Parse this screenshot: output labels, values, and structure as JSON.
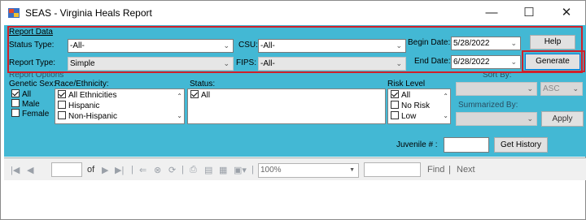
{
  "window": {
    "title": "SEAS - Virginia Heals Report",
    "controls": {
      "minimize": "—",
      "maximize": "☐",
      "close": "✕"
    }
  },
  "report_data": {
    "section_label": "Report Data",
    "status_type": {
      "label": "Status Type:",
      "value": "-All-"
    },
    "report_type": {
      "label": "Report Type:",
      "value": "Simple"
    },
    "csu": {
      "label": "CSU:",
      "value": "-All-"
    },
    "fips": {
      "label": "FIPS:",
      "value": "-All-"
    },
    "begin_date": {
      "label": "Begin Date:",
      "value": "5/28/2022"
    },
    "end_date": {
      "label": "End Date:",
      "value": "6/28/2022"
    },
    "help_label": "Help",
    "generate_label": "Generate"
  },
  "report_options": {
    "section_label": "Report Options",
    "genetic_sex": {
      "label": "Genetic Sex:",
      "items": [
        {
          "label": "All",
          "checked": true
        },
        {
          "label": "Male",
          "checked": false
        },
        {
          "label": "Female",
          "checked": false
        }
      ]
    },
    "race": {
      "label": "Race/Ethnicity:",
      "items": [
        {
          "label": "All Ethnicities",
          "checked": true
        },
        {
          "label": "Hispanic",
          "checked": false
        },
        {
          "label": "Non-Hispanic",
          "checked": false
        }
      ]
    },
    "status": {
      "label": "Status:",
      "items": [
        {
          "label": "All",
          "checked": true
        }
      ]
    },
    "risk": {
      "label": "Risk Level",
      "items": [
        {
          "label": "All",
          "checked": true
        },
        {
          "label": "No Risk",
          "checked": false
        },
        {
          "label": "Low",
          "checked": false
        }
      ]
    },
    "sort_by": {
      "label": "Sort By:",
      "value": "",
      "order": "ASC"
    },
    "summarized_by": {
      "label": "Summarized By:",
      "value": ""
    },
    "apply_label": "Apply"
  },
  "juvenile": {
    "label": "Juvenile # :",
    "value": "",
    "button": "Get History"
  },
  "viewer_toolbar": {
    "page_value": "",
    "of_label": "of",
    "zoom": "100%",
    "find_value": "",
    "find_label": "Find",
    "separator": "|",
    "next_label": "Next"
  }
}
